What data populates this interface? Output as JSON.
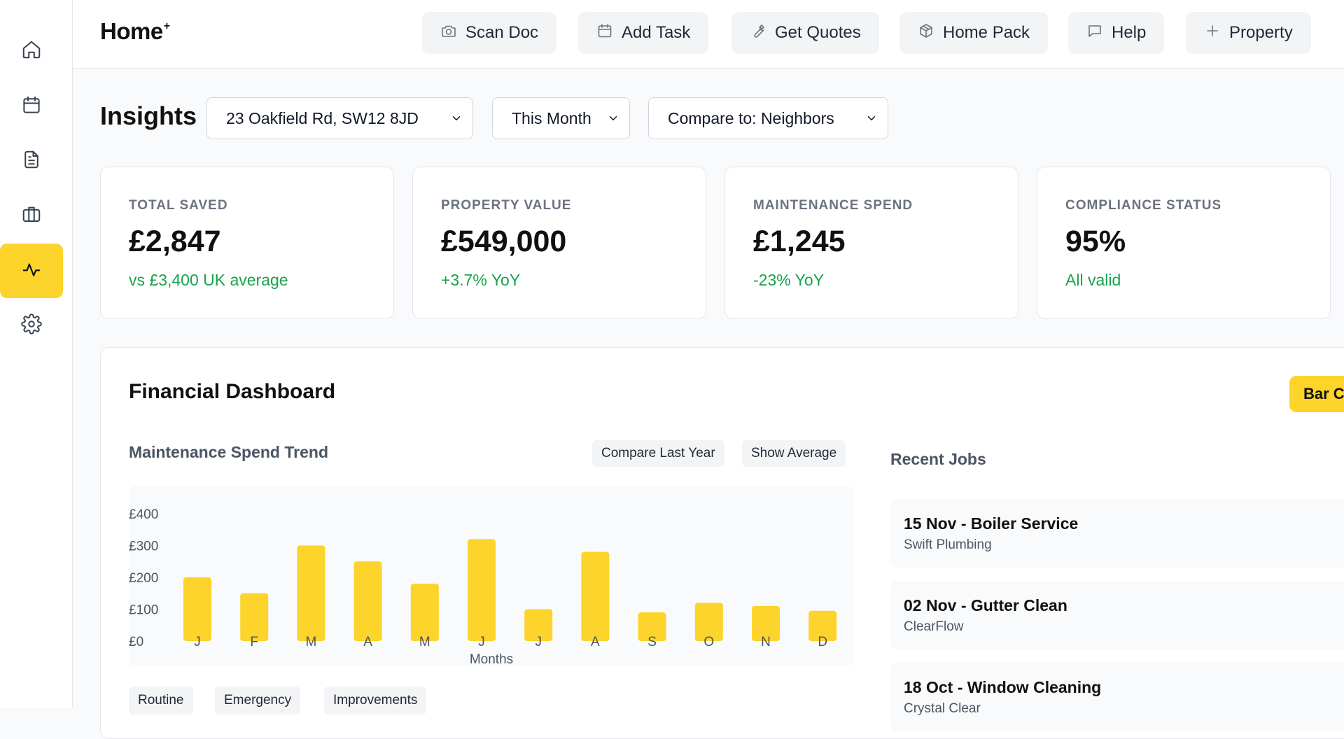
{
  "sidebar": {
    "items": [
      {
        "icon": "home-icon"
      },
      {
        "icon": "calendar-icon"
      },
      {
        "icon": "document-icon"
      },
      {
        "icon": "briefcase-icon"
      },
      {
        "icon": "activity-icon",
        "active": true
      },
      {
        "icon": "gear-icon"
      }
    ]
  },
  "header": {
    "brand": "Home",
    "brand_mark": "+",
    "buttons": [
      {
        "label": "Scan Doc",
        "icon": "camera-icon"
      },
      {
        "label": "Add Task",
        "icon": "calendar-icon"
      },
      {
        "label": "Get Quotes",
        "icon": "wrench-icon"
      },
      {
        "label": "Home Pack",
        "icon": "package-icon"
      },
      {
        "label": "Help",
        "icon": "chat-icon"
      },
      {
        "label": "Property",
        "icon": "plus-icon"
      }
    ]
  },
  "insights": {
    "title": "Insights",
    "property_select": "23 Oakfield Rd, SW12 8JD",
    "period_select": "This Month",
    "compare_select": "Compare to: Neighbors"
  },
  "stats": [
    {
      "label": "TOTAL SAVED",
      "value": "£2,847",
      "sub": "vs £3,400 UK average"
    },
    {
      "label": "PROPERTY VALUE",
      "value": "£549,000",
      "sub": "+3.7% YoY"
    },
    {
      "label": "MAINTENANCE SPEND",
      "value": "£1,245",
      "sub": "-23% YoY"
    },
    {
      "label": "COMPLIANCE STATUS",
      "value": "95%",
      "sub": "All valid"
    }
  ],
  "dashboard": {
    "title": "Financial Dashboard",
    "toggle_label": "Bar C",
    "chart_title": "Maintenance Spend Trend",
    "compare_button": "Compare Last Year",
    "average_button": "Show Average",
    "categories": [
      "Routine",
      "Emergency",
      "Improvements"
    ],
    "jobs_title": "Recent Jobs",
    "jobs": [
      {
        "title": "15 Nov - Boiler Service",
        "company": "Swift Plumbing"
      },
      {
        "title": "02 Nov - Gutter Clean",
        "company": "ClearFlow"
      },
      {
        "title": "18 Oct - Window Cleaning",
        "company": "Crystal Clear"
      }
    ]
  },
  "colors": {
    "accent": "#fcd42b",
    "positive": "#16a34a",
    "muted": "#6b7280"
  },
  "chart_data": {
    "type": "bar",
    "categories": [
      "J",
      "F",
      "M",
      "A",
      "M",
      "J",
      "J",
      "A",
      "S",
      "O",
      "N",
      "D"
    ],
    "values": [
      200,
      150,
      300,
      250,
      180,
      320,
      100,
      280,
      90,
      120,
      110,
      95
    ],
    "xlabel": "Months",
    "ylabel": "",
    "ylim": [
      0,
      400
    ],
    "yticks": [
      "£0",
      "£100",
      "£200",
      "£300",
      "£400"
    ],
    "grid": false,
    "color": "#fcd42b"
  }
}
